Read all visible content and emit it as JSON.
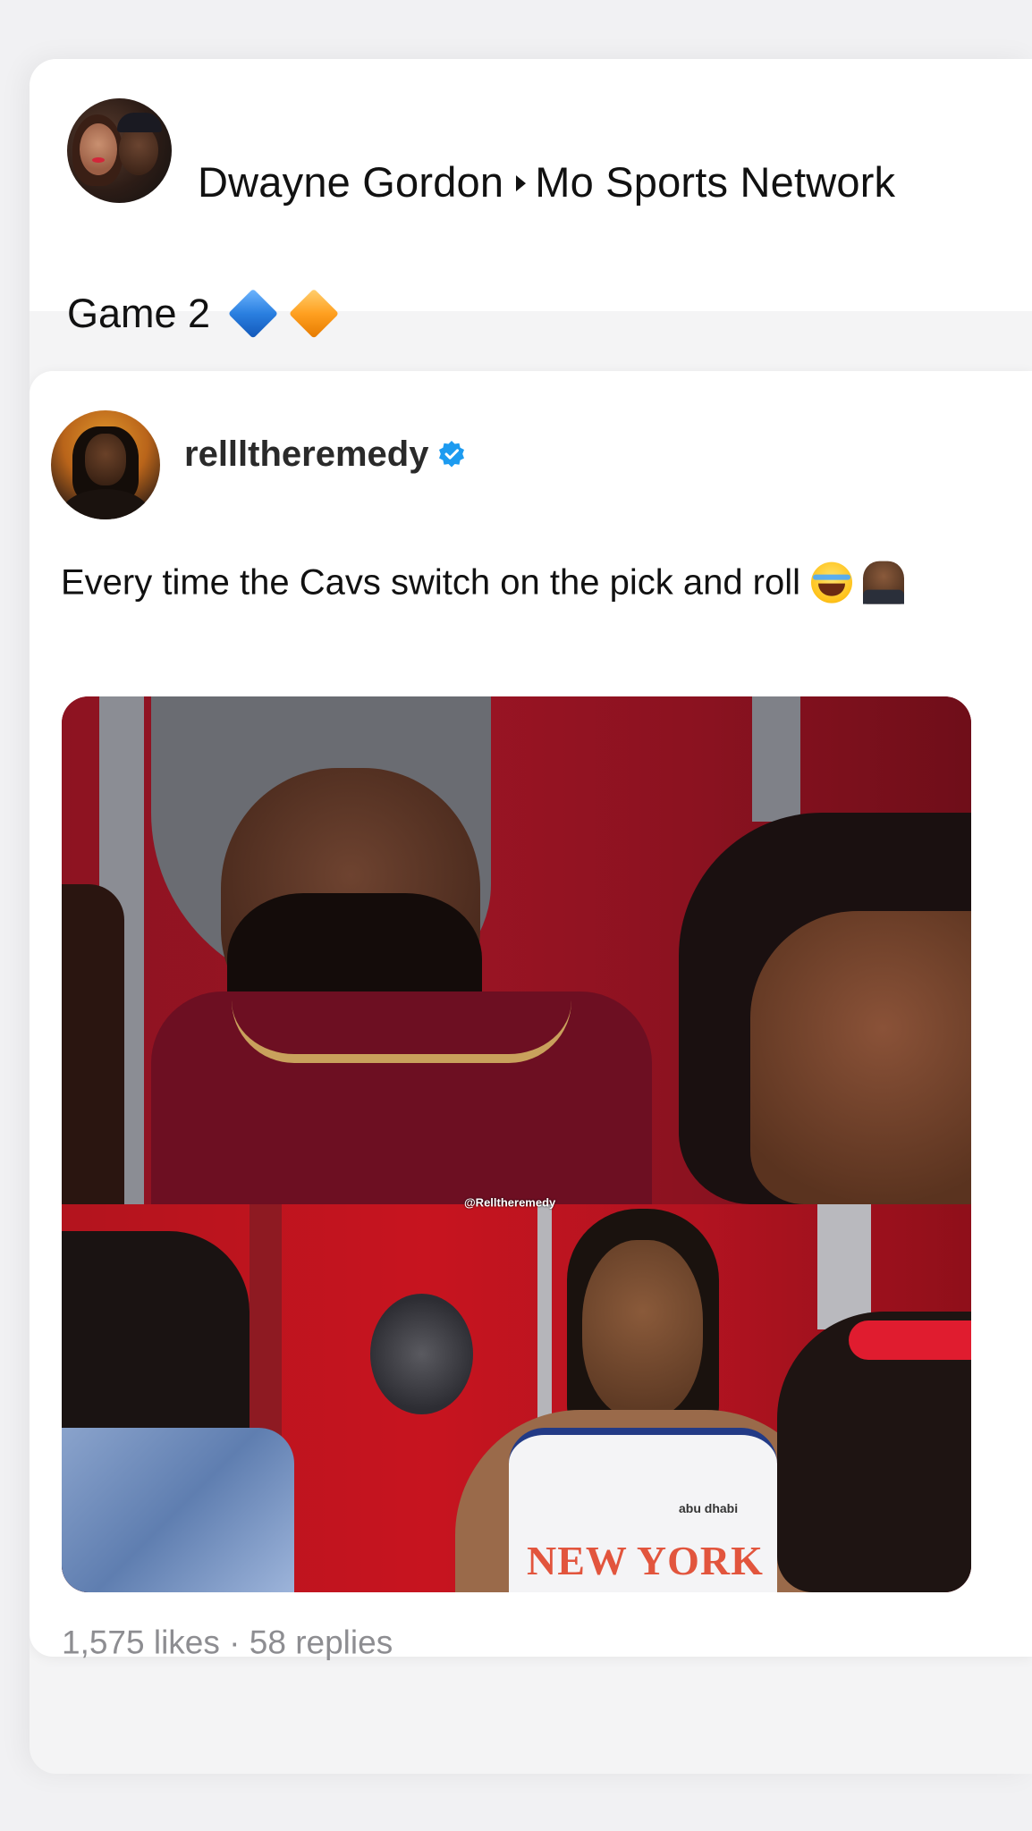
{
  "post": {
    "author": "Dwayne Gordon",
    "group": "Mo Sports Network",
    "caption": "Game 2",
    "caption_emojis": [
      "blue-diamond",
      "orange-diamond"
    ]
  },
  "shared_post": {
    "username": "rellltheremedy",
    "verified": true,
    "text": "Every time the Cavs switch on the pick and roll",
    "text_emojis": [
      "face-with-tears-of-joy",
      "person-facepalming"
    ],
    "image": {
      "watermark": "@Relltheremedy",
      "jersey_text": "NEW YORK",
      "sponsor_text": "abu dhabi"
    },
    "stats": "1,575 likes · 58 replies"
  },
  "colors": {
    "background": "#f1f1f3",
    "card": "#ffffff",
    "verified_blue": "#1d9bf0",
    "stats_gray": "#8d8d91"
  }
}
